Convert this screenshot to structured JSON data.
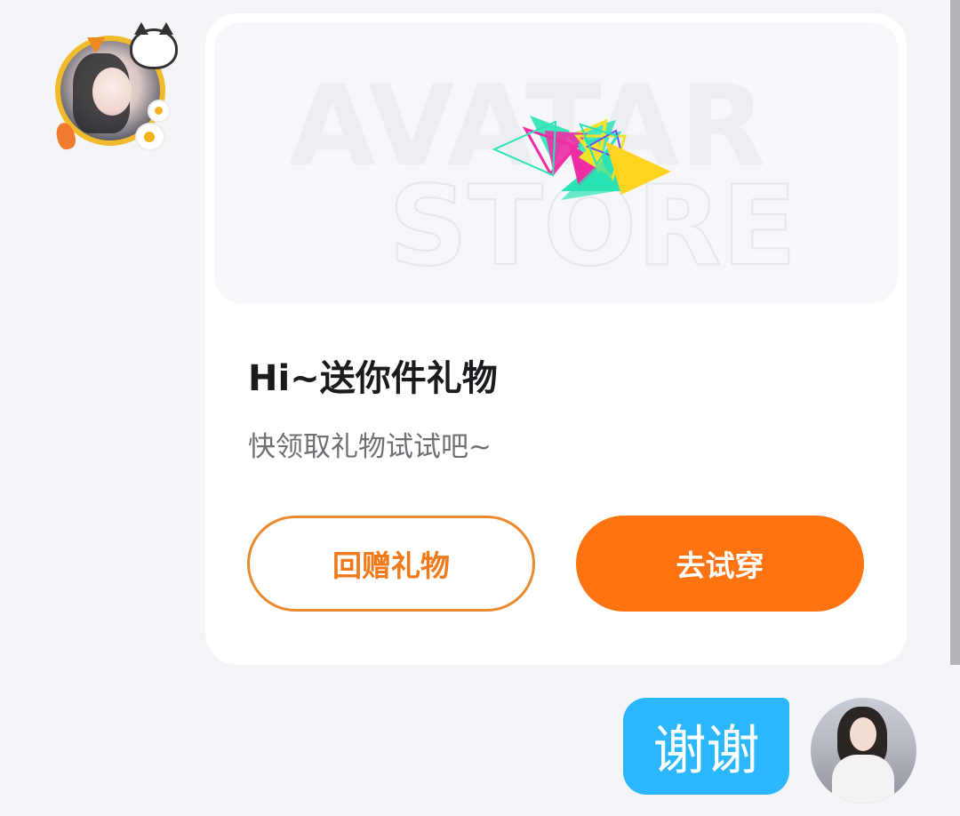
{
  "banner": {
    "line1": "AVATAR",
    "line2": "STORE"
  },
  "gift_card": {
    "title": "Hi~送你件礼物",
    "subtitle": "快领取礼物试试吧~",
    "return_gift_label": "回赠礼物",
    "try_on_label": "去试穿"
  },
  "reply_message": {
    "text": "谢谢"
  },
  "colors": {
    "accent_orange": "#ff7411",
    "outline_orange": "#e98a2e",
    "bubble_blue": "#2bb7fb",
    "background": "#f3f5f8"
  },
  "icons": [
    "sender-avatar",
    "gift-logo-triangles",
    "user-avatar"
  ]
}
